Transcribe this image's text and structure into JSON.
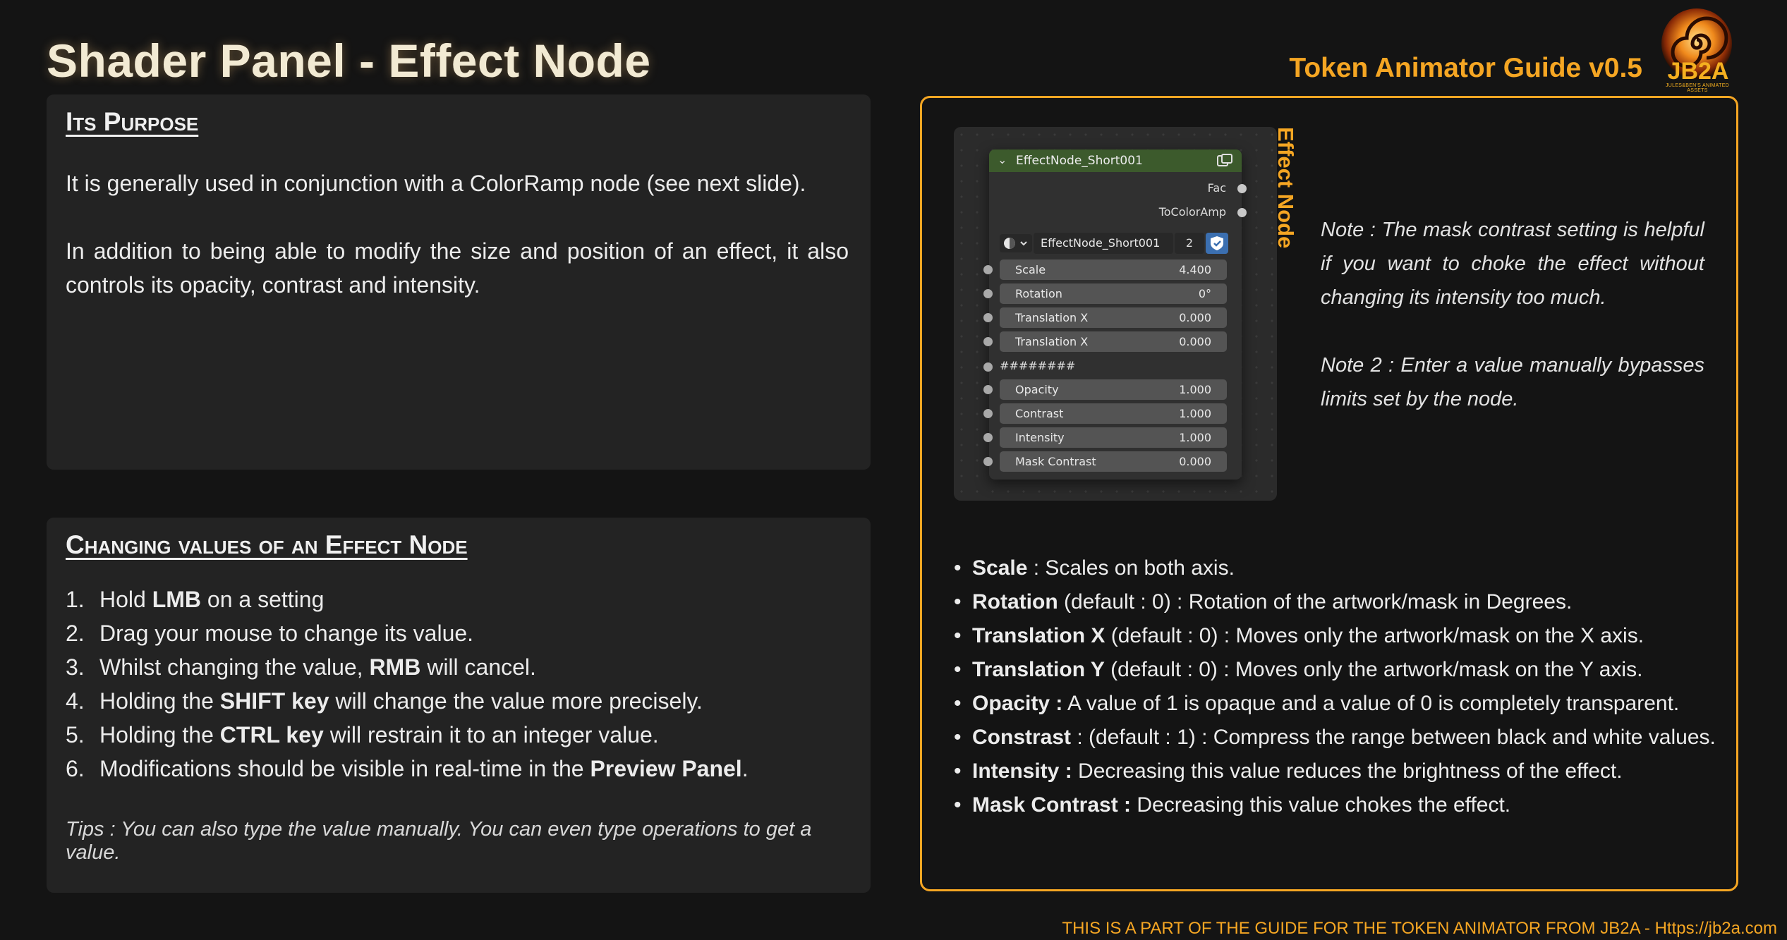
{
  "header": {
    "title": "Shader Panel - Effect Node",
    "guide": "Token Animator Guide v0.5",
    "logo_text": "JB2A",
    "logo_sub": "JULES&BEN'S ANIMATED ASSETS"
  },
  "purpose": {
    "heading": "Its Purpose",
    "p1": "It is generally used in conjunction with a ColorRamp node (see next slide).",
    "p2": "In addition to being able to modify the size and position of an effect, it also controls its opacity, contrast and intensity."
  },
  "changing": {
    "heading": "Changing values of an Effect Node",
    "steps": [
      {
        "num": "1.",
        "pre": "Hold ",
        "bold": "LMB",
        "post": " on a setting"
      },
      {
        "num": "2.",
        "pre": "Drag your mouse to change its value.",
        "bold": "",
        "post": ""
      },
      {
        "num": "3.",
        "pre": "Whilst changing the value, ",
        "bold": "RMB",
        "post": " will cancel."
      },
      {
        "num": "4.",
        "pre": "Holding the ",
        "bold": "SHIFT key",
        "post": " will change the value more precisely."
      },
      {
        "num": "5.",
        "pre": "Holding the ",
        "bold": "CTRL key",
        "post": " will restrain it to an integer value."
      },
      {
        "num": "6.",
        "pre": "Modifications should be visible in real-time in the ",
        "bold": "Preview Panel",
        "post": "."
      }
    ],
    "tips": "Tips : You can also type the value manually. You can even type operations to get a value."
  },
  "node": {
    "label": "Effect Node",
    "name": "EffectNode_Short001",
    "outputs": [
      "Fac",
      "ToColorAmp"
    ],
    "group_name": "EffectNode_Short001",
    "group_count": "2",
    "fields_a": [
      {
        "label": "Scale",
        "value": "4.400"
      },
      {
        "label": "Rotation",
        "value": "0°"
      },
      {
        "label": "Translation X",
        "value": "0.000"
      },
      {
        "label": "Translation X",
        "value": "0.000"
      }
    ],
    "separator": "########",
    "fields_b": [
      {
        "label": "Opacity",
        "value": "1.000"
      },
      {
        "label": "Contrast",
        "value": "1.000"
      },
      {
        "label": "Intensity",
        "value": "1.000"
      },
      {
        "label": "Mask Contrast",
        "value": "0.000"
      }
    ]
  },
  "notes": {
    "note1": "Note : The mask contrast setting is helpful if you want to choke the effect without changing its intensity too much.",
    "note2": "Note 2 : Enter a value manually bypasses limits set by the node."
  },
  "bullets": [
    {
      "bold": "Scale",
      "text": " : Scales on both axis."
    },
    {
      "bold": "Rotation",
      "text": " (default : 0) : Rotation of the artwork/mask in Degrees."
    },
    {
      "bold": "Translation X",
      "text": " (default : 0) : Moves only the artwork/mask on the X axis."
    },
    {
      "bold": "Translation Y",
      "text": " (default : 0) : Moves only the artwork/mask on the Y axis."
    },
    {
      "bold": "Opacity :",
      "text": " A value of 1 is opaque and a value of 0 is completely transparent."
    },
    {
      "bold": "Constrast",
      "text": " : (default : 1) : Compress the range between black and white values."
    },
    {
      "bold": "Intensity :",
      "text": " Decreasing this value reduces the brightness of the effect."
    },
    {
      "bold": "Mask Contrast :",
      "text": " Decreasing this value chokes the effect."
    }
  ],
  "footer": "THIS IS A PART OF THE GUIDE FOR THE TOKEN ANIMATOR FROM JB2A - Https://jb2a.com",
  "colors": {
    "accent": "#f5a623",
    "panel": "#232323",
    "background": "#141414",
    "node_header": "#3c5a2c"
  }
}
